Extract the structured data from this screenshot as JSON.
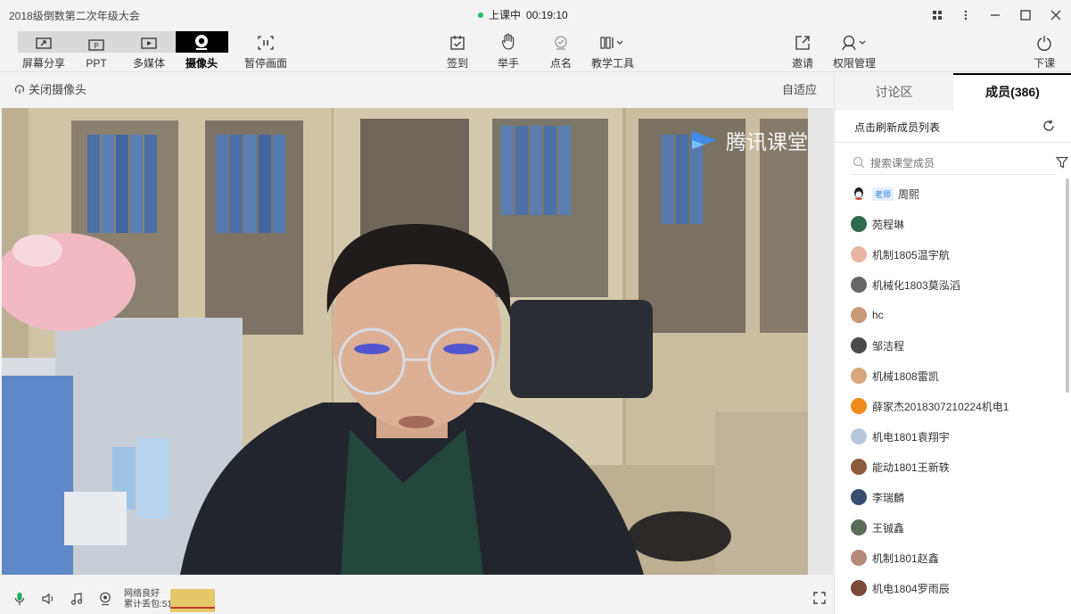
{
  "window": {
    "title": "2018级倒数第二次年级大会",
    "status_text": "上课中",
    "timer": "00:19:10"
  },
  "toolbar": {
    "left": [
      {
        "label": "屏幕分享",
        "icon": "screen-share-icon"
      },
      {
        "label": "PPT",
        "icon": "ppt-icon"
      },
      {
        "label": "多媒体",
        "icon": "multimedia-icon"
      },
      {
        "label": "摄像头",
        "icon": "camera-icon",
        "active": true
      },
      {
        "label": "暂停画面",
        "icon": "pause-frame-icon"
      }
    ],
    "center": [
      {
        "label": "签到",
        "icon": "checkin-icon"
      },
      {
        "label": "举手",
        "icon": "raise-hand-icon"
      },
      {
        "label": "点名",
        "icon": "roll-call-icon"
      },
      {
        "label": "教学工具",
        "icon": "teaching-tools-icon"
      }
    ],
    "right": [
      {
        "label": "邀请",
        "icon": "invite-icon"
      },
      {
        "label": "权限管理",
        "icon": "permission-icon"
      },
      {
        "label": "下课",
        "icon": "end-class-icon"
      }
    ]
  },
  "video": {
    "close_camera_label": "关闭摄像头",
    "fit_label": "自适应",
    "watermark": "腾讯课堂"
  },
  "bottom": {
    "network_status": "网络良好",
    "packet_loss": "累计丢包:51"
  },
  "panel": {
    "tab_discussion": "讨论区",
    "tab_members": "成员(386)",
    "refresh_label": "点击刷新成员列表",
    "search_placeholder": "搜索课堂成员",
    "members": [
      {
        "name": "周熙",
        "badge": "老师",
        "color": "#d33b2c"
      },
      {
        "name": "苑程琳",
        "color": "#2f6b4a"
      },
      {
        "name": "机制1805温宇航",
        "color": "#e8b4a4"
      },
      {
        "name": "机械化1803莫泓滔",
        "color": "#666666"
      },
      {
        "name": "hc",
        "color": "#c89a7a"
      },
      {
        "name": "邹洁程",
        "color": "#4a4a4a"
      },
      {
        "name": "机械1808雷凯",
        "color": "#d9a57c"
      },
      {
        "name": "薛家杰2018307210224机电1",
        "color": "#f08a1c"
      },
      {
        "name": "机电1801袁翔宇",
        "color": "#b7c7d9"
      },
      {
        "name": "能动1801王新轶",
        "color": "#8c5a3c"
      },
      {
        "name": "李瑞麟",
        "color": "#3a4d6e"
      },
      {
        "name": "王铖鑫",
        "color": "#5a6b5a"
      },
      {
        "name": "机制1801赵鑫",
        "color": "#b58a7a"
      },
      {
        "name": "机电1804罗雨辰",
        "color": "#7a4a3a"
      }
    ]
  }
}
